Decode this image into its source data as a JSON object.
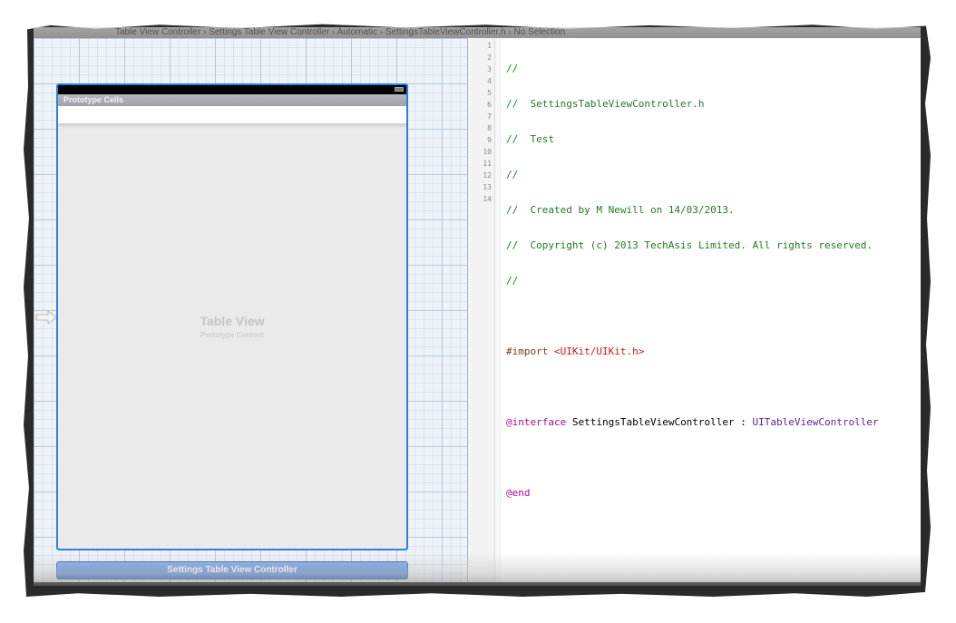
{
  "toolbar": {
    "breadcrumb": "Table View Controller  ›  Settings Table View Controller  ›  Automatic  ›  SettingsTableViewController.h  ›  No Selection"
  },
  "storyboard": {
    "section_header": "Prototype Cells",
    "table_view_title": "Table View",
    "table_view_subtitle": "Prototype Content",
    "scene_label": "Settings Table View Controller"
  },
  "editor": {
    "line_numbers": [
      "1",
      "2",
      "3",
      "4",
      "5",
      "6",
      "7",
      "8",
      "9",
      "10",
      "11",
      "12",
      "13",
      "14"
    ],
    "lines": {
      "l1": "//",
      "l2": "//  SettingsTableViewController.h",
      "l3": "//  Test",
      "l4": "//",
      "l5": "//  Created by M Newill on 14/03/2013.",
      "l6": "//  Copyright (c) 2013 TechAsis Limited. All rights reserved.",
      "l7": "//",
      "l9_directive": "#import ",
      "l9_header": "<UIKit/UIKit.h>",
      "l11_keyword": "@interface",
      "l11_name": " SettingsTableViewController : ",
      "l11_super": "UITableViewController",
      "l13": "@end"
    }
  },
  "colors": {
    "selection_blue": "#2f7de0",
    "comment_green": "#237a23",
    "keyword_purple": "#aa0d91",
    "string_red": "#c41a16"
  }
}
